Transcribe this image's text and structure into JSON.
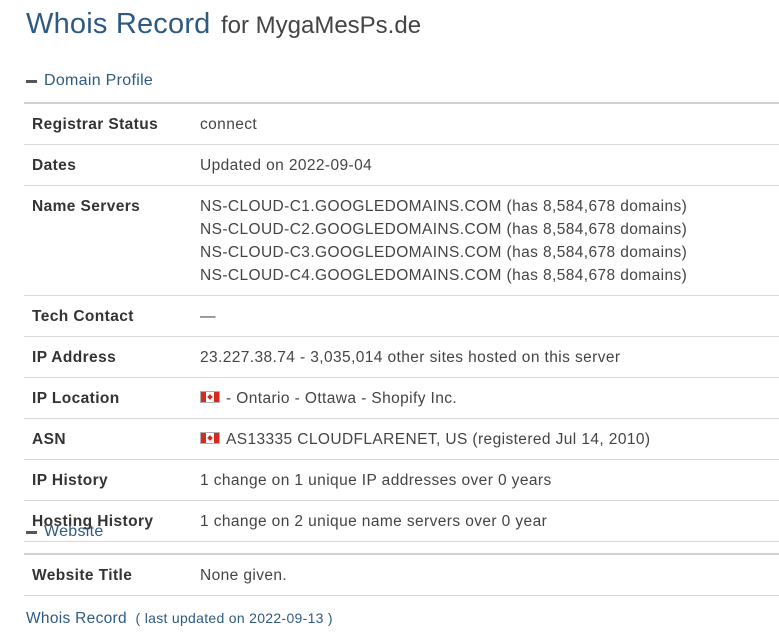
{
  "title": {
    "main": "Whois Record",
    "sub": "for MygaMesPs.de"
  },
  "sections": {
    "domain_profile": "Domain Profile",
    "website": "Website"
  },
  "profile": {
    "registrar_status": {
      "label": "Registrar Status",
      "value": "connect"
    },
    "dates": {
      "label": "Dates",
      "value": "Updated on 2022-09-04"
    },
    "name_servers": {
      "label": "Name Servers",
      "values": [
        "NS-CLOUD-C1.GOOGLEDOMAINS.COM (has 8,584,678 domains)",
        "NS-CLOUD-C2.GOOGLEDOMAINS.COM (has 8,584,678 domains)",
        "NS-CLOUD-C3.GOOGLEDOMAINS.COM (has 8,584,678 domains)",
        "NS-CLOUD-C4.GOOGLEDOMAINS.COM (has 8,584,678 domains)"
      ]
    },
    "tech_contact": {
      "label": "Tech Contact",
      "value": "—"
    },
    "ip_address": {
      "label": "IP Address",
      "value": "23.227.38.74 - 3,035,014 other sites hosted on this server"
    },
    "ip_location": {
      "label": "IP Location",
      "value": "- Ontario - Ottawa - Shopify Inc.",
      "flag": "canada-flag-icon"
    },
    "asn": {
      "label": "ASN",
      "value": "AS13335 CLOUDFLARENET, US (registered Jul 14, 2010)",
      "flag": "canada-flag-icon"
    },
    "ip_history": {
      "label": "IP History",
      "value": "1 change on 1 unique IP addresses over 0 years"
    },
    "hosting_history": {
      "label": "Hosting History",
      "value": "1 change on 2 unique name servers over 0 year"
    }
  },
  "website": {
    "website_title": {
      "label": "Website Title",
      "value": "None given."
    }
  },
  "footer": {
    "link": "Whois Record",
    "note": "( last updated on 2022-09-13 )"
  },
  "colors": {
    "heading": "#2e5a82",
    "text": "#444444",
    "divider": "#d9d9d9"
  }
}
